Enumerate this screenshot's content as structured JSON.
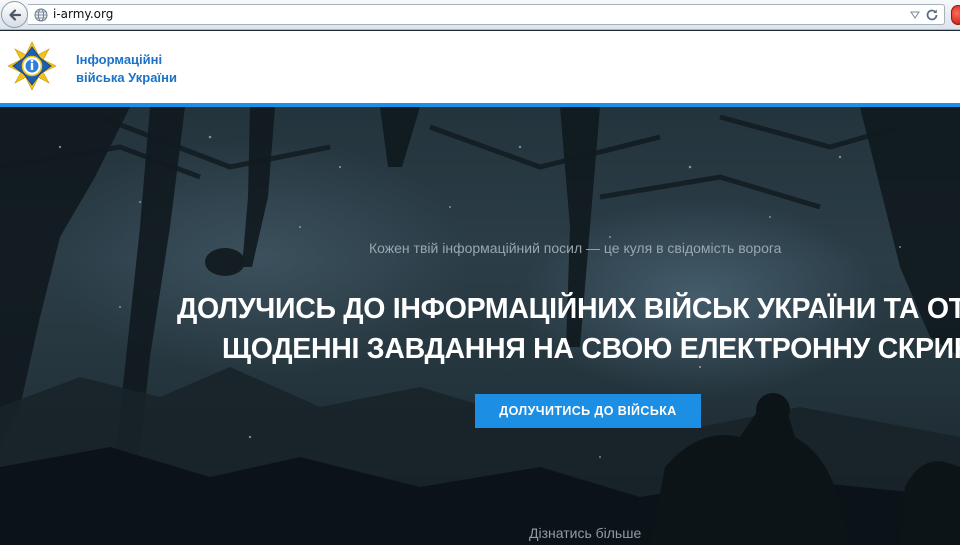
{
  "browser": {
    "url": "i-army.org",
    "icons": [
      "back-arrow-icon",
      "globe-icon",
      "dropdown-icon",
      "reload-icon",
      "stop-icon"
    ]
  },
  "header": {
    "logo_line1": "Інформаційні",
    "logo_line2": "війська України",
    "accent_color": "#1d8fe6"
  },
  "hero": {
    "tagline": "Кожен твій інформаційний посил — це куля в свідомість ворога",
    "title_line1": "ДОЛУЧИСЬ ДО ІНФОРМАЦІЙНИХ ВІЙСЬК УКРАЇНИ ТА ОТРИМ",
    "title_line2": "ЩОДЕННІ ЗАВДАННЯ НА СВОЮ ЕЛЕКТРОННУ СКРИНЬКУ!",
    "cta_label": "ДОЛУЧИТИСЬ ДО ВІЙСЬКА",
    "learn_more": "Дізнатись більше",
    "cta_color": "#1c8fe4"
  }
}
